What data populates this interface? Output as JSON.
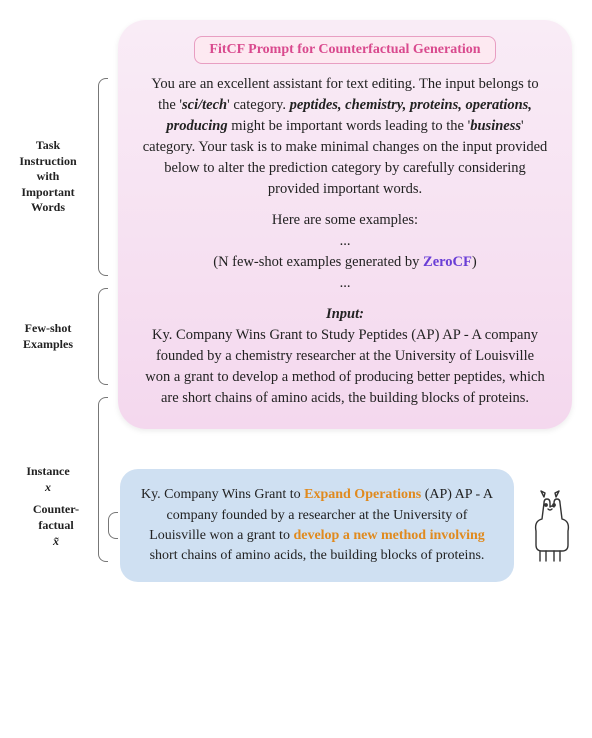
{
  "title_badge": "FitCF Prompt for Counterfactual Generation",
  "labels": {
    "task_instruction": "Task\nInstruction\nwith\nImportant\nWords",
    "few_shot": "Few-shot\nExamples",
    "instance": "Instance",
    "instance_var": "x",
    "counterfactual": "Counter-\nfactual",
    "counterfactual_var": "x̃"
  },
  "prompt": {
    "instr_pre": "You are an excellent assistant for text editing. The input belongs to the '",
    "cat_src": "sci/tech",
    "instr_mid1": "' category. ",
    "important_words": "peptides, chemistry, proteins, operations, producing",
    "instr_mid2": " might be important words leading to the '",
    "cat_tgt": "business",
    "instr_post": "' category. Your task is to make minimal changes on the input provided below to alter the prediction category by carefully considering provided important words.",
    "examples_intro": "Here are some examples:",
    "ellipsis": "...",
    "examples_line_pre": "(N few-shot examples generated by ",
    "zerocf": "ZeroCF",
    "examples_line_post": ")",
    "input_label": "Input:",
    "input_text": "Ky. Company Wins Grant to Study Peptides (AP) AP - A company founded by a chemistry researcher at the University of Louisville won a grant to develop a method of producing better peptides, which are short chains of amino acids, the building blocks of proteins."
  },
  "counterfactual": {
    "pre1": "Ky. Company Wins Grant to ",
    "hl1": "Expand Operations",
    "mid1": " (AP) AP - A company founded by a researcher at the University of Louisville won a grant to ",
    "hl2": "develop a new method involving",
    "post": " short chains of amino acids, the building blocks of proteins."
  }
}
